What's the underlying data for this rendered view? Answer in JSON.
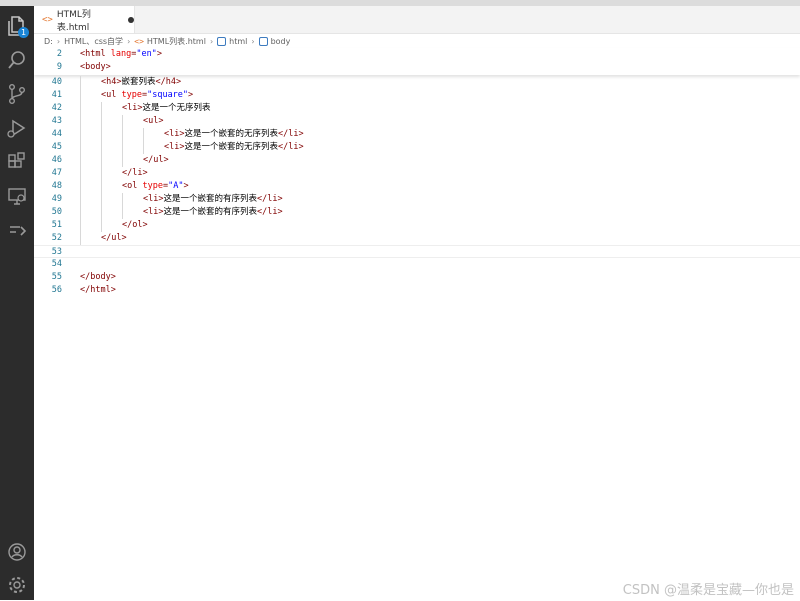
{
  "tab": {
    "title": "HTML列表.html"
  },
  "breadcrumb": {
    "drive": "D:",
    "folder": "HTML、css自学",
    "file": "HTML列表.html",
    "el1": "html",
    "el2": "body"
  },
  "activity_icons": [
    "explorer-icon",
    "search-icon",
    "source-control-icon",
    "run-debug-icon",
    "extensions-icon",
    "remote-explorer-icon",
    "testing-icon",
    "account-icon",
    "settings-gear-icon"
  ],
  "explorer_badge": "1",
  "sticky_lines": [
    {
      "num": "2",
      "indent": 0,
      "tokens": [
        [
          "tag",
          "<html "
        ],
        [
          "attr",
          "lang"
        ],
        [
          "tag",
          "="
        ],
        [
          "str",
          "\"en\""
        ],
        [
          "tag",
          ">"
        ]
      ]
    },
    {
      "num": "9",
      "indent": 0,
      "tokens": [
        [
          "tag",
          "<body>"
        ]
      ]
    }
  ],
  "lines": [
    {
      "num": "40",
      "indent": 1,
      "tokens": [
        [
          "tag",
          "<h4>"
        ],
        [
          "text",
          "嵌套列表"
        ],
        [
          "tag",
          "</h4>"
        ]
      ]
    },
    {
      "num": "41",
      "indent": 1,
      "tokens": [
        [
          "tag",
          "<ul "
        ],
        [
          "attr",
          "type"
        ],
        [
          "tag",
          "="
        ],
        [
          "str",
          "\"square\""
        ],
        [
          "tag",
          ">"
        ]
      ]
    },
    {
      "num": "42",
      "indent": 2,
      "tokens": [
        [
          "tag",
          "<li>"
        ],
        [
          "text",
          "这是一个无序列表"
        ]
      ]
    },
    {
      "num": "43",
      "indent": 3,
      "tokens": [
        [
          "tag",
          "<ul>"
        ]
      ]
    },
    {
      "num": "44",
      "indent": 4,
      "tokens": [
        [
          "tag",
          "<li>"
        ],
        [
          "text",
          "这是一个嵌套的无序列表"
        ],
        [
          "tag",
          "</li>"
        ]
      ]
    },
    {
      "num": "45",
      "indent": 4,
      "tokens": [
        [
          "tag",
          "<li>"
        ],
        [
          "text",
          "这是一个嵌套的无序列表"
        ],
        [
          "tag",
          "</li>"
        ]
      ]
    },
    {
      "num": "46",
      "indent": 3,
      "tokens": [
        [
          "tag",
          "</ul>"
        ]
      ]
    },
    {
      "num": "47",
      "indent": 2,
      "tokens": [
        [
          "tag",
          "</li>"
        ]
      ]
    },
    {
      "num": "48",
      "indent": 2,
      "tokens": [
        [
          "tag",
          "<ol "
        ],
        [
          "attr",
          "type"
        ],
        [
          "tag",
          "="
        ],
        [
          "str",
          "\"A\""
        ],
        [
          "tag",
          ">"
        ]
      ]
    },
    {
      "num": "49",
      "indent": 3,
      "tokens": [
        [
          "tag",
          "<li>"
        ],
        [
          "text",
          "这是一个嵌套的有序列表"
        ],
        [
          "tag",
          "</li>"
        ]
      ]
    },
    {
      "num": "50",
      "indent": 3,
      "tokens": [
        [
          "tag",
          "<li>"
        ],
        [
          "text",
          "这是一个嵌套的有序列表"
        ],
        [
          "tag",
          "</li>"
        ]
      ]
    },
    {
      "num": "51",
      "indent": 2,
      "tokens": [
        [
          "tag",
          "</ol>"
        ]
      ]
    },
    {
      "num": "52",
      "indent": 1,
      "tokens": [
        [
          "tag",
          "</ul>"
        ]
      ]
    },
    {
      "num": "53",
      "indent": 0,
      "tokens": [],
      "current": true
    },
    {
      "num": "54",
      "indent": 0,
      "tokens": []
    },
    {
      "num": "55",
      "indent": 0,
      "tokens": [
        [
          "tag",
          "</body>"
        ]
      ]
    },
    {
      "num": "56",
      "indent": 0,
      "tokens": [
        [
          "tag",
          "</html>"
        ]
      ]
    }
  ],
  "watermark": "CSDN @温柔是宝藏—你也是"
}
